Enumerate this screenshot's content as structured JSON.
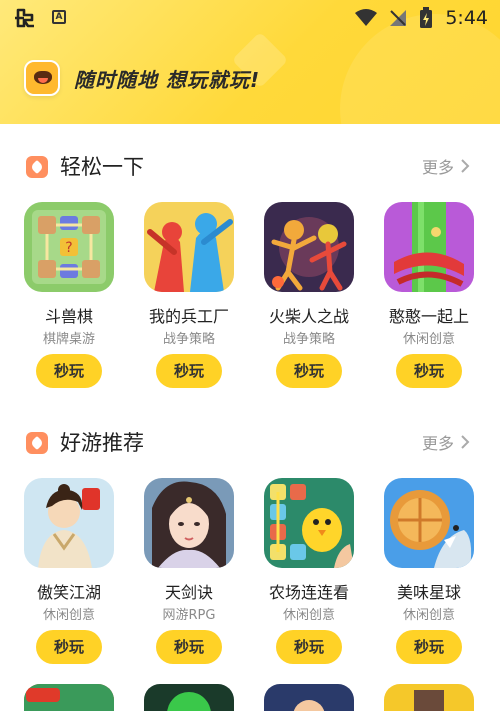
{
  "status_bar": {
    "time": "5:44",
    "app_icon": "bug-icon",
    "notification_icon": "a-notification-icon"
  },
  "header": {
    "slogan": "随时随地 想玩就玩!"
  },
  "sections": [
    {
      "title": "轻松一下",
      "more_label": "更多",
      "games": [
        {
          "name": "斗兽棋",
          "category": "棋牌桌游",
          "play_label": "秒玩"
        },
        {
          "name": "我的兵工厂",
          "category": "战争策略",
          "play_label": "秒玩"
        },
        {
          "name": "火柴人之战",
          "category": "战争策略",
          "play_label": "秒玩"
        },
        {
          "name": "憨憨一起上",
          "category": "休闲创意",
          "play_label": "秒玩"
        }
      ]
    },
    {
      "title": "好游推荐",
      "more_label": "更多",
      "games": [
        {
          "name": "傲笑江湖",
          "category": "休闲创意",
          "play_label": "秒玩"
        },
        {
          "name": "天剑诀",
          "category": "网游RPG",
          "play_label": "秒玩"
        },
        {
          "name": "农场连连看",
          "category": "休闲创意",
          "play_label": "秒玩"
        },
        {
          "name": "美味星球",
          "category": "休闲创意",
          "play_label": "秒玩"
        }
      ]
    }
  ],
  "colors": {
    "accent": "#ffd226",
    "header_top": "#ffe97a",
    "section_icon": "#ff8f5f"
  }
}
